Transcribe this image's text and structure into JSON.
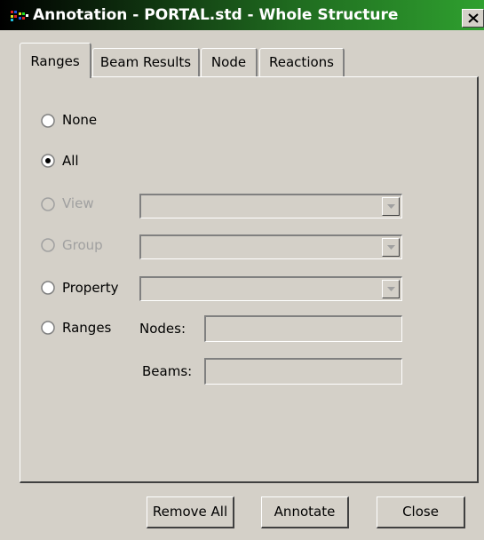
{
  "window": {
    "title": "Annotation - PORTAL.std - Whole Structure",
    "close_icon": "close-icon",
    "app_icon": "structure-app-icon"
  },
  "tabs": [
    {
      "label": "Ranges",
      "active": true
    },
    {
      "label": "Beam Results",
      "active": false
    },
    {
      "label": "Node",
      "active": false
    },
    {
      "label": "Reactions",
      "active": false
    }
  ],
  "options": {
    "none": {
      "label": "None",
      "checked": false,
      "enabled": true
    },
    "all": {
      "label": "All",
      "checked": true,
      "enabled": true
    },
    "view": {
      "label": "View",
      "checked": false,
      "enabled": false,
      "value": ""
    },
    "group": {
      "label": "Group",
      "checked": false,
      "enabled": false,
      "value": ""
    },
    "property": {
      "label": "Property",
      "checked": false,
      "enabled": true,
      "value": ""
    },
    "ranges": {
      "label": "Ranges",
      "checked": false,
      "enabled": true
    }
  },
  "ranges_fields": {
    "nodes_label": "Nodes:",
    "nodes_value": "",
    "beams_label": "Beams:",
    "beams_value": ""
  },
  "buttons": {
    "remove_all": "Remove All",
    "annotate": "Annotate",
    "close": "Close"
  },
  "colors": {
    "dialog_bg": "#d4d0c8",
    "title_gradient_start": "#000000",
    "title_gradient_end": "#2fa02f",
    "disabled_text": "#a0a0a0"
  }
}
